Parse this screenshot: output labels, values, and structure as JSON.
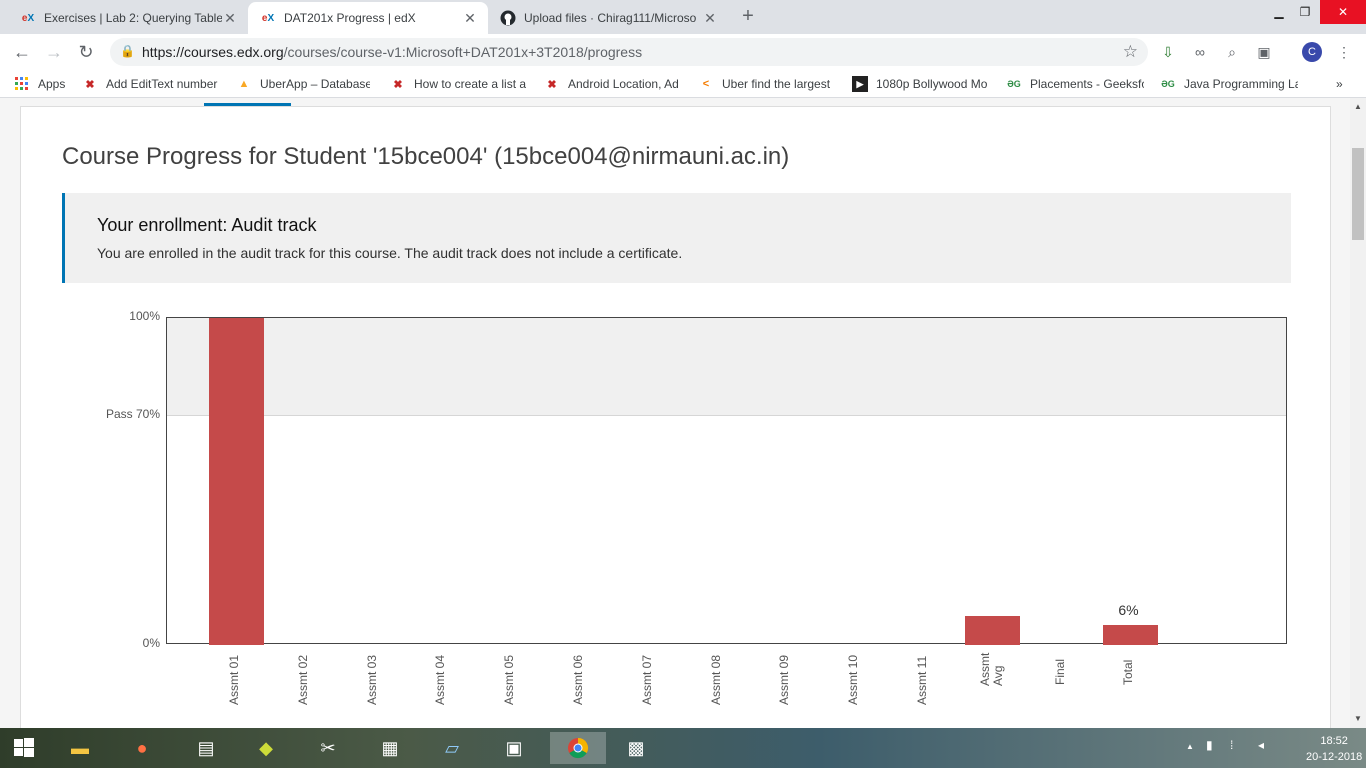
{
  "browser": {
    "tabs": [
      {
        "favicon": "edx-logo-icon",
        "title": "Exercises | Lab 2: Querying Table",
        "active": false
      },
      {
        "favicon": "edx-logo-icon",
        "title": "DAT201x Progress | edX",
        "active": true
      },
      {
        "favicon": "github-icon",
        "title": "Upload files · Chirag111/Microso",
        "active": false
      }
    ],
    "new_tab_symbol": "+",
    "url_host": "https://courses.edx.org",
    "url_path": "/courses/course-v1:Microsoft+DAT201x+3T2018/progress",
    "profile_initial": "C",
    "bookmarks": [
      {
        "label": "Apps",
        "icon": "apps-grid-icon"
      },
      {
        "label": "Add EditText number",
        "icon": "x-logo-icon"
      },
      {
        "label": "UberApp – Database",
        "icon": "firebase-icon"
      },
      {
        "label": "How to create a list a",
        "icon": "x-logo-icon"
      },
      {
        "label": "Android Location, Ad",
        "icon": "x-logo-icon"
      },
      {
        "label": "Uber find the largest",
        "icon": "leetcode-icon"
      },
      {
        "label": "1080p Bollywood Mo",
        "icon": "play-icon"
      },
      {
        "label": "Placements - Geeksfo",
        "icon": "geeksforgeeks-icon"
      },
      {
        "label": "Java Programming La",
        "icon": "geeksforgeeks-icon"
      }
    ],
    "more_bookmarks": "»"
  },
  "page": {
    "heading": "Course Progress for Student '15bce004' (15bce004@nirmauni.ac.in)",
    "enrollment_title": "Your enrollment: Audit track",
    "enrollment_text": "You are enrolled in the audit track for this course. The audit track does not include a certificate."
  },
  "chart_data": {
    "type": "bar",
    "categories": [
      "Assmt 01",
      "Assmt 02",
      "Assmt 03",
      "Assmt 04",
      "Assmt 05",
      "Assmt 06",
      "Assmt 07",
      "Assmt 08",
      "Assmt 09",
      "Assmt 10",
      "Assmt 11",
      "Assmt Avg",
      "Final",
      "Total"
    ],
    "values": [
      100,
      0,
      0,
      0,
      0,
      0,
      0,
      0,
      0,
      0,
      0,
      9,
      0,
      6
    ],
    "ylim": [
      0,
      100
    ],
    "yticks": [
      {
        "value": 0,
        "label": "0%"
      },
      {
        "value": 70,
        "label": "Pass 70%"
      },
      {
        "value": 100,
        "label": "100%"
      }
    ],
    "pass_threshold": 70,
    "data_labels": [
      {
        "category": "Total",
        "label": "6%"
      }
    ],
    "bar_color": "#c54a4a",
    "pass_band_color": "#f0f0f0"
  },
  "taskbar": {
    "time": "18:52",
    "date": "20-12-2018"
  }
}
